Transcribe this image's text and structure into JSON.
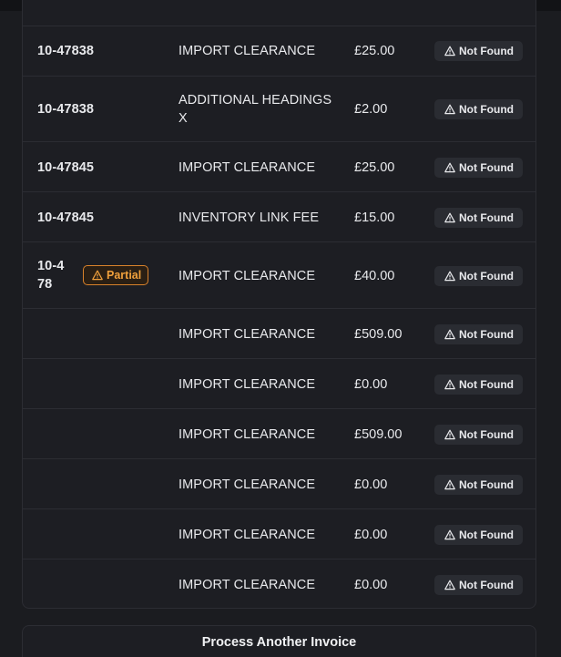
{
  "status_label": "Not Found",
  "partial_label": "Partial",
  "rows": [
    {
      "ref": "10-47838",
      "description": "IMPORT CLEARANCE",
      "amount": "£25.00"
    },
    {
      "ref": "10-47838",
      "description": "ADDITIONAL HEADINGS X",
      "amount": "£2.00"
    },
    {
      "ref": "10-47845",
      "description": "IMPORT CLEARANCE",
      "amount": "£25.00"
    },
    {
      "ref": "10-47845",
      "description": "INVENTORY LINK FEE",
      "amount": "£15.00"
    },
    {
      "ref": "10-478",
      "description": "IMPORT CLEARANCE",
      "amount": "£40.00"
    },
    {
      "ref": "",
      "description": "IMPORT CLEARANCE",
      "amount": "£509.00"
    },
    {
      "ref": "",
      "description": "IMPORT CLEARANCE",
      "amount": "£0.00"
    },
    {
      "ref": "",
      "description": "IMPORT CLEARANCE",
      "amount": "£509.00"
    },
    {
      "ref": "",
      "description": "IMPORT CLEARANCE",
      "amount": "£0.00"
    },
    {
      "ref": "",
      "description": "IMPORT CLEARANCE",
      "amount": "£0.00"
    },
    {
      "ref": "",
      "description": "IMPORT CLEARANCE",
      "amount": "£0.00"
    }
  ],
  "process_button_label": "Process Another Invoice",
  "colors": {
    "background": "#1b1c20",
    "partial_accent": "#f0a03c",
    "badge_bg": "#2a2c32"
  },
  "icons": {
    "status": "warning-triangle-icon",
    "partial": "warning-triangle-icon"
  }
}
